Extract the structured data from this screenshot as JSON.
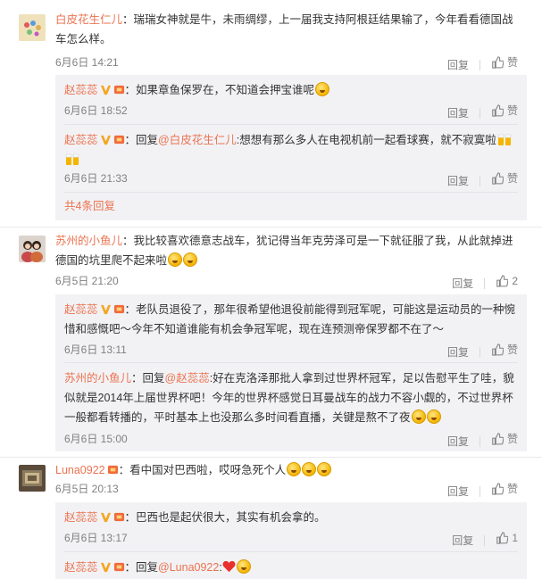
{
  "comments": [
    {
      "user": "白皮花生仁儿",
      "text": "：瑞瑞女神就是牛，未雨绸缪，上一届我支持阿根廷结果输了，今年看看德国战车怎么样。",
      "time": "6月6日 14:21",
      "reply": "回复",
      "like": "赞",
      "replies": [
        {
          "user": "赵蕊蕊",
          "text": "：如果章鱼保罗在，不知道会押宝谁呢",
          "time": "6月6日 18:52",
          "reply": "回复",
          "like": "赞"
        },
        {
          "user": "赵蕊蕊",
          "prefix": "：回复",
          "mention": "@白皮花生仁儿",
          "text": ":想想有那么多人在电视机前一起看球赛，就不寂寞啦",
          "time": "6月6日 21:33",
          "reply": "回复",
          "like": "赞"
        }
      ],
      "more": "共4条回复"
    },
    {
      "user": "苏州的小鱼儿",
      "text": "：我比较喜欢德意志战车，犹记得当年克劳泽可是一下就征服了我，从此就掉进德国的坑里爬不起来啦",
      "time": "6月5日 21:20",
      "reply": "回复",
      "like_count": "2",
      "replies": [
        {
          "user": "赵蕊蕊",
          "text": "：老队员退役了，那年很希望他退役前能得到冠军呢，可能这是运动员的一种惋惜和感慨吧～今年不知道谁能有机会争冠军呢，现在连预测帝保罗都不在了～",
          "time": "6月6日 13:11",
          "reply": "回复",
          "like": "赞"
        },
        {
          "user": "苏州的小鱼儿",
          "prefix": "：回复",
          "mention": "@赵蕊蕊",
          "text": ":好在克洛泽那批人拿到过世界杯冠军，足以告慰平生了哇，貌似就是2014年上届世界杯吧！今年的世界杯感觉日耳曼战车的战力不容小觑的，不过世界杯一般都看转播的，平时基本上也没那么多时间看直播，关键是熬不了夜",
          "time": "6月6日 15:00",
          "reply": "回复",
          "like": "赞"
        }
      ]
    },
    {
      "user": "Luna0922",
      "text": "：看中国对巴西啦，哎呀急死个人",
      "time": "6月5日 20:13",
      "reply": "回复",
      "like": "赞",
      "replies": [
        {
          "user": "赵蕊蕊",
          "text": "：巴西也是起伏很大，其实有机会拿的。",
          "time": "6月6日 13:17",
          "reply": "回复",
          "like_count": "1"
        },
        {
          "user": "赵蕊蕊",
          "prefix": "：回复",
          "mention": "@Luna0922",
          "text": ":"
        }
      ]
    }
  ],
  "colors": {
    "link": "#eb7350",
    "text": "#333333",
    "meta": "#808080",
    "subbox": "#f2f2f5"
  }
}
